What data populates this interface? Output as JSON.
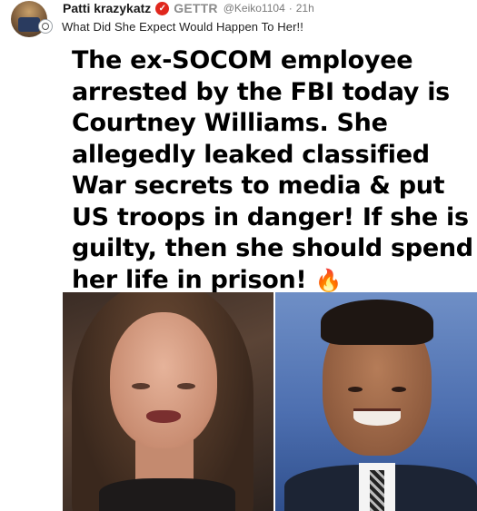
{
  "post": {
    "author_name": "Patti krazykatz",
    "verified_icon": "verified-badge-icon",
    "platform": "GETTR",
    "handle": "@Keiko1104",
    "separator": "·",
    "timestamp": "21h",
    "text": "What Did She Expect Would Happen To Her!!"
  },
  "media": {
    "headline": "The ex-SOCOM employee arrested by the FBI today is Courtney Williams. She allegedly leaked classified War secrets to media & put US troops in danger! If she is guilty, then she should spend her life in prison!",
    "headline_emoji": "🔥",
    "colors": {
      "verified_badge": "#e0271d",
      "headline_text": "#000000"
    }
  }
}
